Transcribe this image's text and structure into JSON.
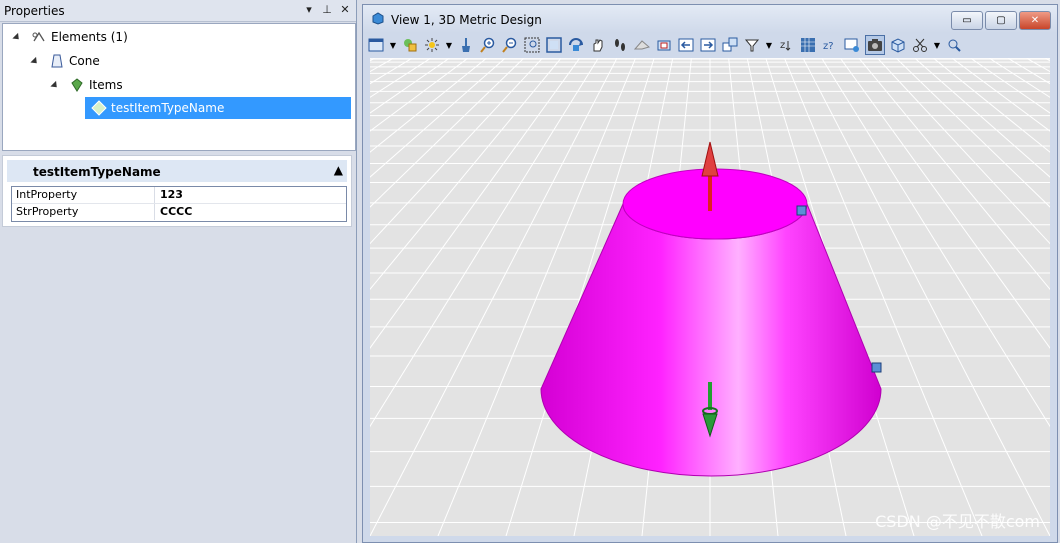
{
  "properties_panel": {
    "title": "Properties",
    "buttons": {
      "dropdown": "▾",
      "pin": "⊥",
      "close": "✕"
    }
  },
  "tree": {
    "elements_label": "Elements (1)",
    "cone_label": "Cone",
    "items_label": "Items",
    "selected_label": "testItemTypeName"
  },
  "property_grid": {
    "header": "testItemTypeName",
    "collapse_glyph": "▲",
    "rows": [
      {
        "name": "IntProperty",
        "value": "123"
      },
      {
        "name": "StrProperty",
        "value": "CCCC"
      }
    ]
  },
  "view": {
    "title": "View 1, 3D Metric Design",
    "window_buttons": {
      "minimize": "▭",
      "restore": "▢",
      "close": "✕"
    },
    "cone_color": "#ff00ff"
  },
  "watermark": "CSDN @不见不散com",
  "colors": {
    "selection": "#3399ff",
    "grid_line": "#ffffff",
    "arrow_up": "#e02020",
    "arrow_down": "#208a30"
  }
}
